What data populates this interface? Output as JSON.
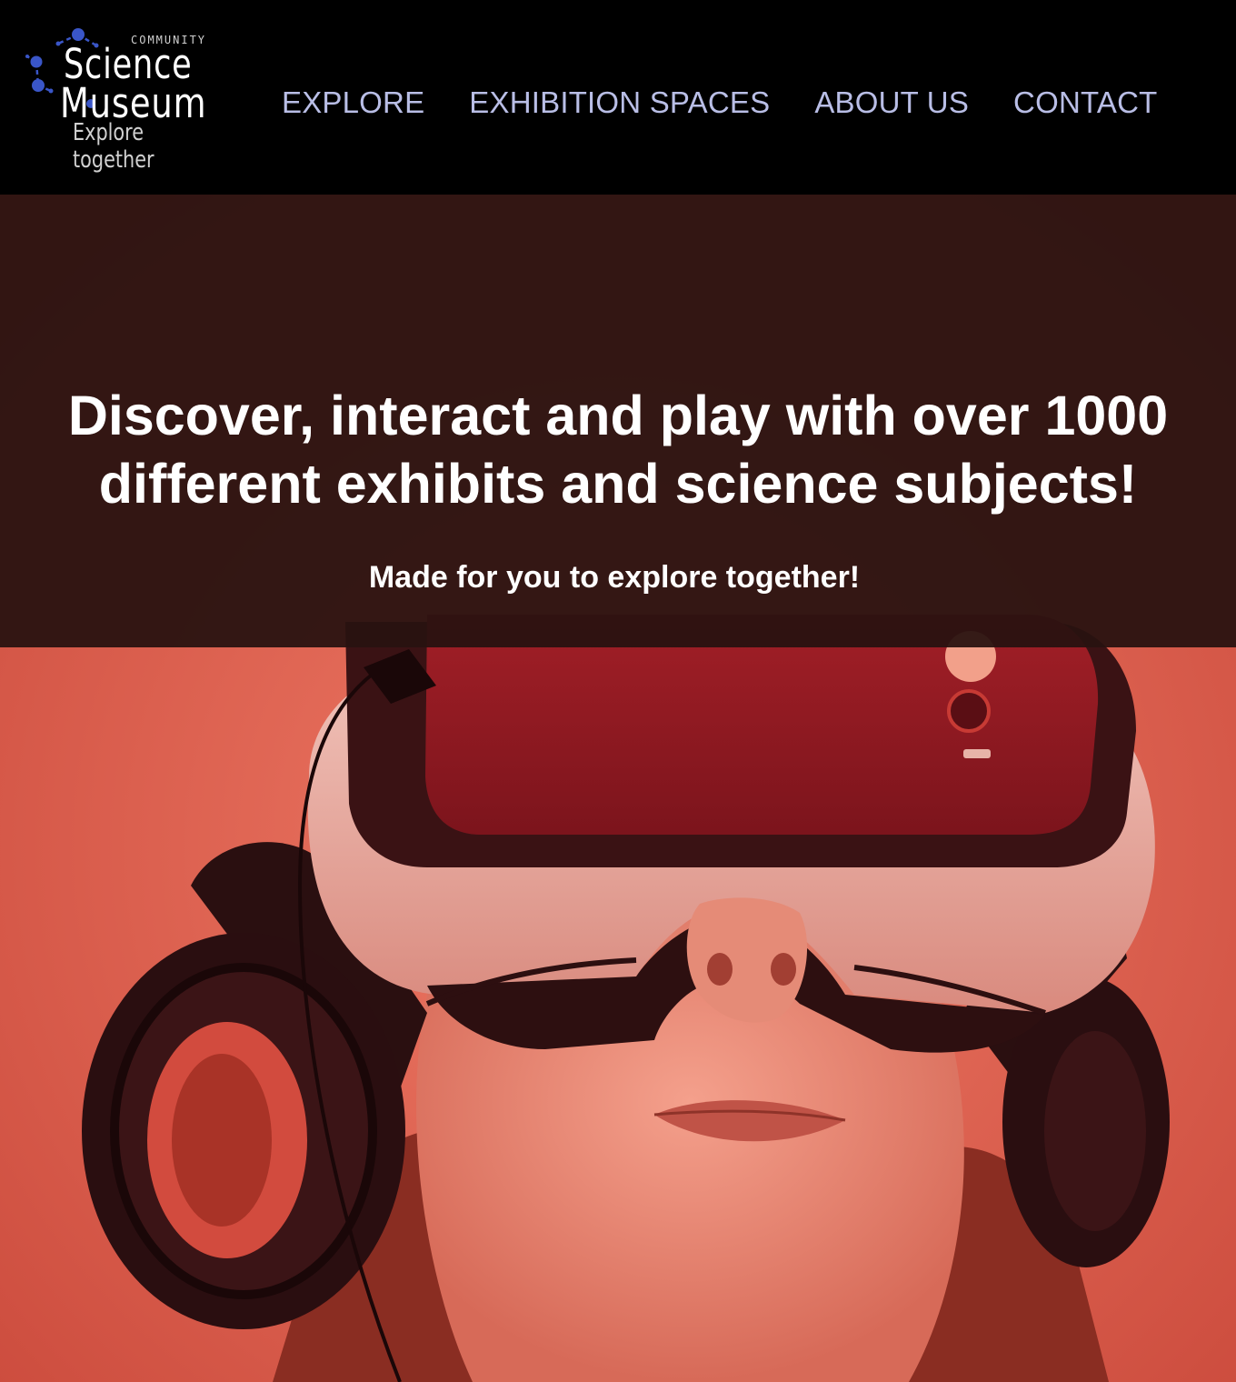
{
  "logo": {
    "community": "COMMUNITY",
    "science": "Science",
    "museum": "Museum",
    "tagline": "Explore together",
    "accent_color": "#3a56c8"
  },
  "nav": {
    "items": [
      {
        "label": "EXPLORE"
      },
      {
        "label": "EXHIBITION SPACES"
      },
      {
        "label": "ABOUT US"
      },
      {
        "label": "CONTACT"
      }
    ],
    "color": "#b9bee6"
  },
  "hero": {
    "headline": "Discover, interact and play with over 1000 different exhibits and science subjects!",
    "subheadline": "Made for you to explore together!",
    "image_icon": "vr-headset-photo"
  }
}
